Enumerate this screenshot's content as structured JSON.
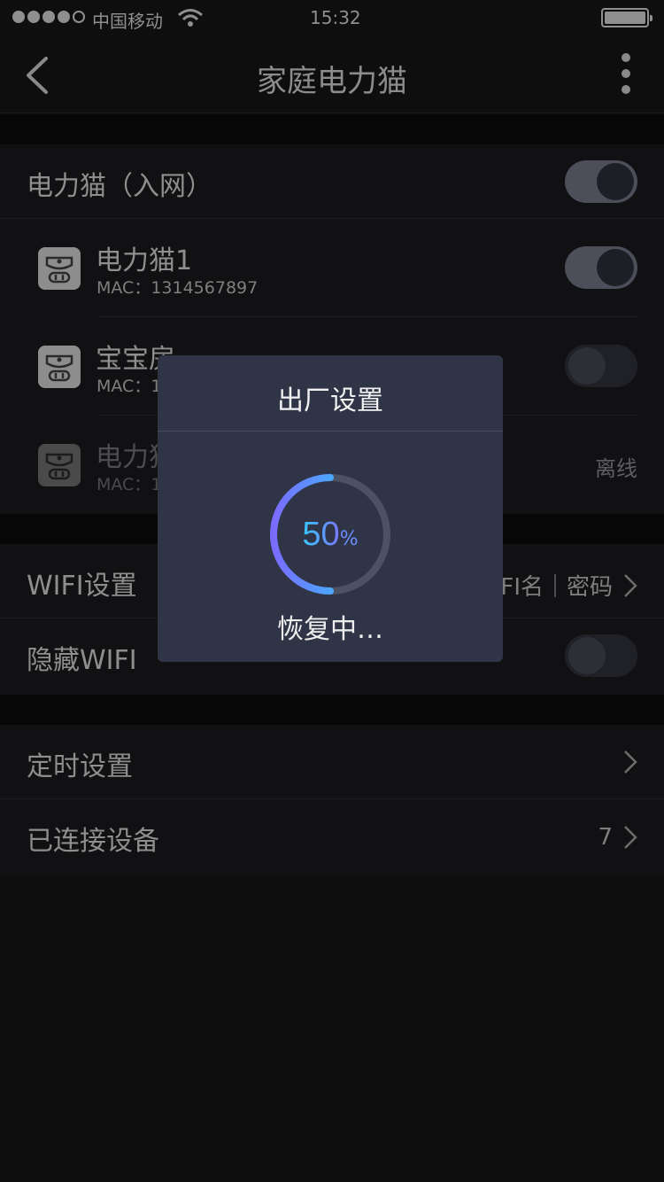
{
  "status_bar": {
    "carrier": "中国移动",
    "time": "15:32"
  },
  "nav": {
    "title": "家庭电力猫"
  },
  "network": {
    "label": "电力猫（入网）",
    "toggle_on": true
  },
  "devices": [
    {
      "name": "电力猫1",
      "mac": "MAC：1314567897",
      "toggle_on": true,
      "status": ""
    },
    {
      "name": "宝宝房",
      "mac": "MAC：1",
      "toggle_on": false,
      "status": ""
    },
    {
      "name": "电力猫",
      "mac": "MAC：1",
      "toggle_on": null,
      "status": "离线"
    }
  ],
  "wifi": {
    "settings_label": "WIFI设置",
    "settings_value": "FI名｜密码",
    "hide_label": "隐藏WIFI",
    "hide_on": false
  },
  "misc": {
    "timer_label": "定时设置",
    "connected_label": "已连接设备",
    "connected_count": "7"
  },
  "modal": {
    "title": "出厂设置",
    "progress": 50,
    "progress_num": "50",
    "progress_unit": "%",
    "status": "恢复中…"
  },
  "colors": {
    "accent_start": "#1ee0ff",
    "accent_end": "#7a6bff",
    "modal_bg": "#2f3547"
  }
}
